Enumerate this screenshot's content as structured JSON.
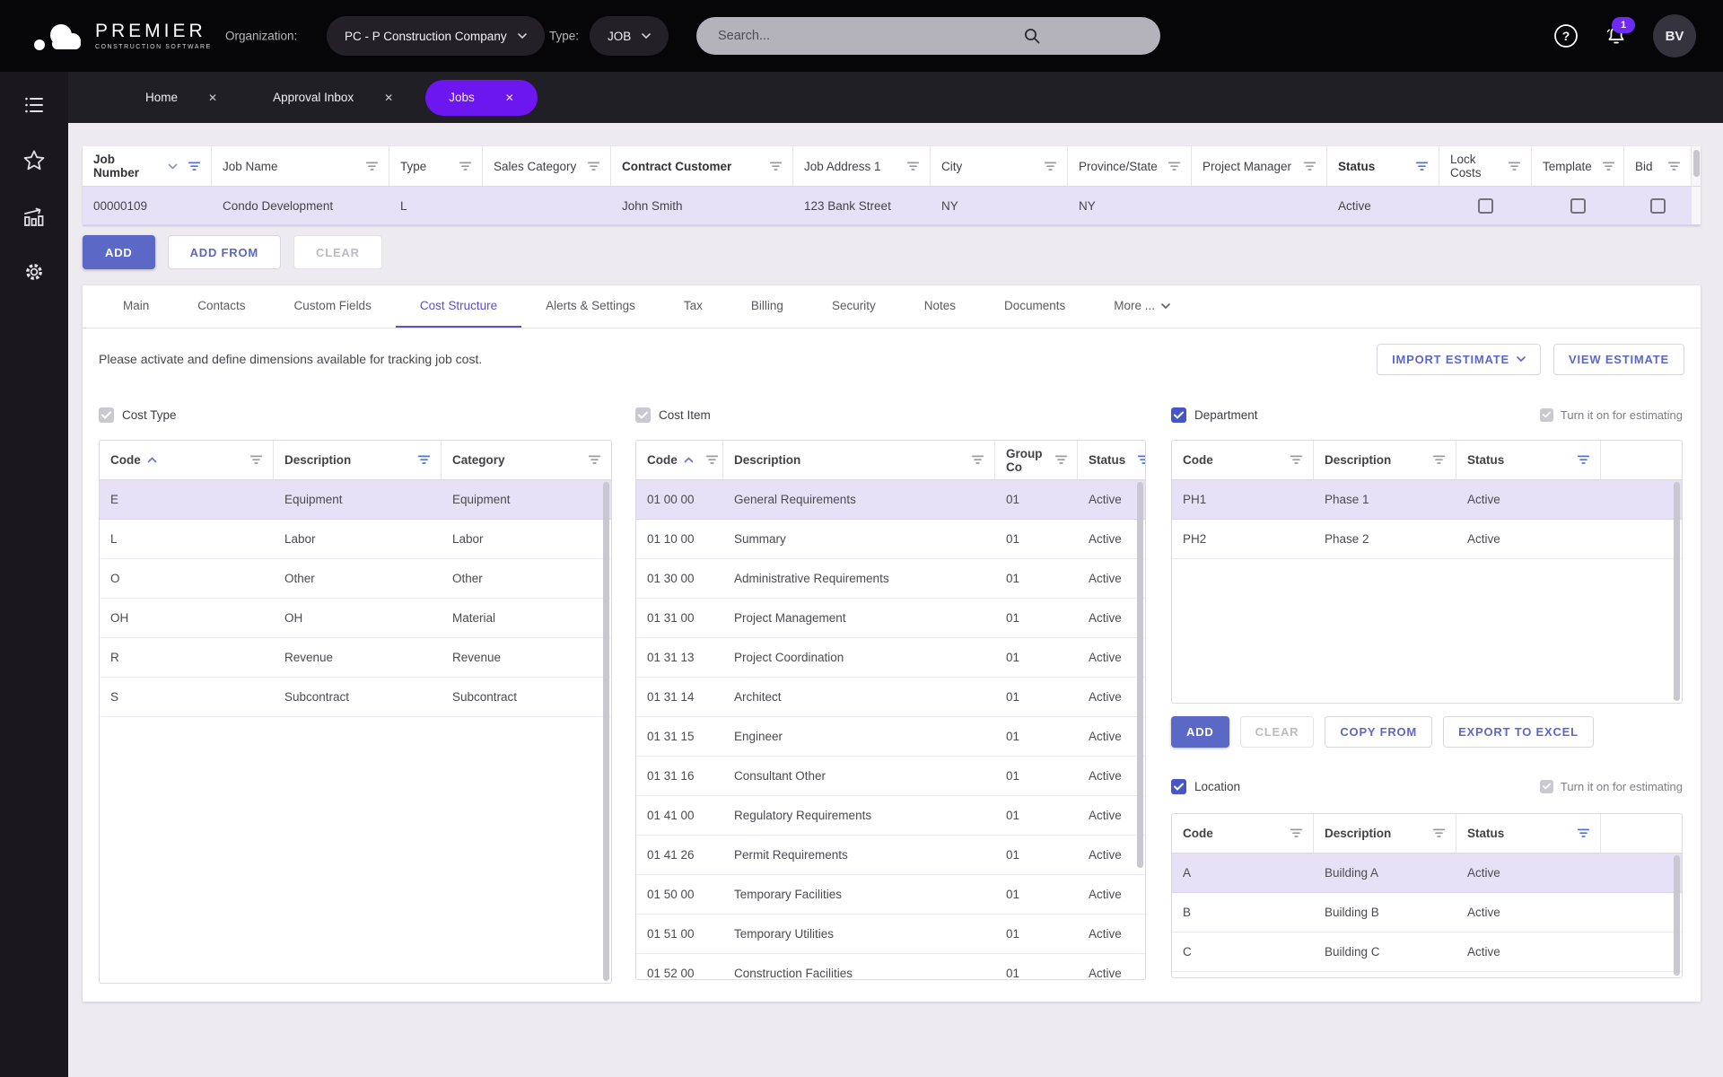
{
  "header": {
    "brand_name": "PREMIER",
    "brand_tagline": "CONSTRUCTION SOFTWARE",
    "organization_label": "Organization:",
    "organization_value": "PC - P Construction Company",
    "type_label": "Type:",
    "type_value": "JOB",
    "search_placeholder": "Search...",
    "notification_count": "1",
    "avatar_initials": "BV"
  },
  "window_tabs": {
    "items": [
      "Home",
      "Approval Inbox",
      "Jobs"
    ],
    "active": "Jobs"
  },
  "jobs_grid": {
    "columns": [
      {
        "label": "Job Number",
        "sort": "desc",
        "filter": "active",
        "emphasis": true
      },
      {
        "label": "Job Name",
        "filter": "default"
      },
      {
        "label": "Type",
        "filter": "default"
      },
      {
        "label": "Sales Category",
        "filter": "default"
      },
      {
        "label": "Contract Customer",
        "filter": "default",
        "emphasis": true
      },
      {
        "label": "Job Address 1",
        "filter": "default"
      },
      {
        "label": "City",
        "filter": "default"
      },
      {
        "label": "Province/State",
        "filter": "default"
      },
      {
        "label": "Project Manager",
        "filter": "default"
      },
      {
        "label": "Status",
        "filter": "active",
        "emphasis": true
      },
      {
        "label": "Lock Costs",
        "filter": "default"
      },
      {
        "label": "Template",
        "filter": "default"
      },
      {
        "label": "Bid",
        "filter": "default"
      }
    ],
    "row_cells": [
      "00000109",
      "Condo Development",
      "L",
      "",
      "John Smith",
      "123 Bank Street",
      "NY",
      "NY",
      "",
      "Active"
    ],
    "row_checkboxes": [
      false,
      false,
      false
    ]
  },
  "actions": {
    "add": "ADD",
    "add_from": "ADD FROM",
    "clear": "CLEAR"
  },
  "detail_tabs": {
    "items": [
      "Main",
      "Contacts",
      "Custom Fields",
      "Cost Structure",
      "Alerts & Settings",
      "Tax",
      "Billing",
      "Security",
      "Notes",
      "Documents",
      "More ..."
    ],
    "active": "Cost Structure"
  },
  "cost_structure": {
    "instruction": "Please activate and define dimensions available for tracking job cost.",
    "import_button": "IMPORT ESTIMATE",
    "view_button": "VIEW ESTIMATE",
    "estimating_label": "Turn it on for estimating",
    "dept_buttons": {
      "add": "ADD",
      "clear": "CLEAR",
      "copy_from": "COPY FROM",
      "export": "EXPORT TO EXCEL"
    },
    "cost_type": {
      "title": "Cost Type",
      "columns": [
        {
          "label": "Code",
          "sort": "asc",
          "filter": "default"
        },
        {
          "label": "Description",
          "filter": "active"
        },
        {
          "label": "Category",
          "filter": "default"
        }
      ],
      "rows": [
        [
          "E",
          "Equipment",
          "Equipment"
        ],
        [
          "L",
          "Labor",
          "Labor"
        ],
        [
          "O",
          "Other",
          "Other"
        ],
        [
          "OH",
          "OH",
          "Material"
        ],
        [
          "R",
          "Revenue",
          "Revenue"
        ],
        [
          "S",
          "Subcontract",
          "Subcontract"
        ]
      ],
      "selected_index": 0
    },
    "cost_item": {
      "title": "Cost Item",
      "columns": [
        {
          "label": "Code",
          "sort": "asc",
          "filter": "default"
        },
        {
          "label": "Description",
          "filter": "default"
        },
        {
          "label": "Group Co",
          "filter": "default"
        },
        {
          "label": "Status",
          "filter": "active"
        }
      ],
      "rows": [
        [
          "01 00 00",
          "General Requirements",
          "01",
          "Active"
        ],
        [
          "01 10 00",
          "Summary",
          "01",
          "Active"
        ],
        [
          "01 30 00",
          "Administrative Requirements",
          "01",
          "Active"
        ],
        [
          "01 31 00",
          "Project Management",
          "01",
          "Active"
        ],
        [
          "01 31 13",
          "Project Coordination",
          "01",
          "Active"
        ],
        [
          "01 31 14",
          "Architect",
          "01",
          "Active"
        ],
        [
          "01 31 15",
          "Engineer",
          "01",
          "Active"
        ],
        [
          "01 31 16",
          "Consultant Other",
          "01",
          "Active"
        ],
        [
          "01 41 00",
          "Regulatory Requirements",
          "01",
          "Active"
        ],
        [
          "01 41 26",
          "Permit Requirements",
          "01",
          "Active"
        ],
        [
          "01 50 00",
          "Temporary Facilities",
          "01",
          "Active"
        ],
        [
          "01 51 00",
          "Temporary Utilities",
          "01",
          "Active"
        ],
        [
          "01 52 00",
          "Construction Facilities",
          "01",
          "Active"
        ]
      ],
      "selected_index": 0
    },
    "department": {
      "title": "Department",
      "columns": [
        {
          "label": "Code",
          "filter": "default"
        },
        {
          "label": "Description",
          "filter": "default"
        },
        {
          "label": "Status",
          "filter": "active"
        },
        {
          "label": ""
        }
      ],
      "rows": [
        [
          "PH1",
          "Phase 1",
          "Active"
        ],
        [
          "PH2",
          "Phase 2",
          "Active"
        ]
      ],
      "selected_index": 0
    },
    "location": {
      "title": "Location",
      "columns": [
        {
          "label": "Code",
          "filter": "default"
        },
        {
          "label": "Description",
          "filter": "default"
        },
        {
          "label": "Status",
          "filter": "active"
        },
        {
          "label": ""
        }
      ],
      "rows": [
        [
          "A",
          "Building A",
          "Active"
        ],
        [
          "B",
          "Building B",
          "Active"
        ],
        [
          "C",
          "Building C",
          "Active"
        ]
      ],
      "selected_index": 0
    }
  }
}
